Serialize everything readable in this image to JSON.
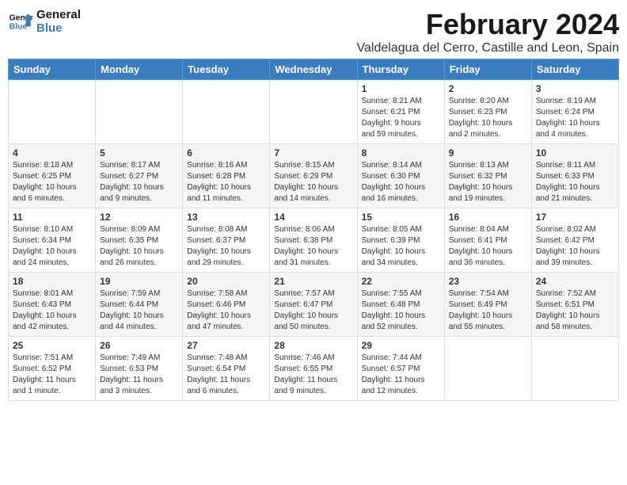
{
  "header": {
    "logo_line1": "General",
    "logo_line2": "Blue",
    "month_title": "February 2024",
    "location": "Valdelagua del Cerro, Castille and Leon, Spain"
  },
  "weekdays": [
    "Sunday",
    "Monday",
    "Tuesday",
    "Wednesday",
    "Thursday",
    "Friday",
    "Saturday"
  ],
  "weeks": [
    [
      {
        "day": "",
        "info": ""
      },
      {
        "day": "",
        "info": ""
      },
      {
        "day": "",
        "info": ""
      },
      {
        "day": "",
        "info": ""
      },
      {
        "day": "1",
        "info": "Sunrise: 8:21 AM\nSunset: 6:21 PM\nDaylight: 9 hours\nand 59 minutes."
      },
      {
        "day": "2",
        "info": "Sunrise: 8:20 AM\nSunset: 6:23 PM\nDaylight: 10 hours\nand 2 minutes."
      },
      {
        "day": "3",
        "info": "Sunrise: 8:19 AM\nSunset: 6:24 PM\nDaylight: 10 hours\nand 4 minutes."
      }
    ],
    [
      {
        "day": "4",
        "info": "Sunrise: 8:18 AM\nSunset: 6:25 PM\nDaylight: 10 hours\nand 6 minutes."
      },
      {
        "day": "5",
        "info": "Sunrise: 8:17 AM\nSunset: 6:27 PM\nDaylight: 10 hours\nand 9 minutes."
      },
      {
        "day": "6",
        "info": "Sunrise: 8:16 AM\nSunset: 6:28 PM\nDaylight: 10 hours\nand 11 minutes."
      },
      {
        "day": "7",
        "info": "Sunrise: 8:15 AM\nSunset: 6:29 PM\nDaylight: 10 hours\nand 14 minutes."
      },
      {
        "day": "8",
        "info": "Sunrise: 8:14 AM\nSunset: 6:30 PM\nDaylight: 10 hours\nand 16 minutes."
      },
      {
        "day": "9",
        "info": "Sunrise: 8:13 AM\nSunset: 6:32 PM\nDaylight: 10 hours\nand 19 minutes."
      },
      {
        "day": "10",
        "info": "Sunrise: 8:11 AM\nSunset: 6:33 PM\nDaylight: 10 hours\nand 21 minutes."
      }
    ],
    [
      {
        "day": "11",
        "info": "Sunrise: 8:10 AM\nSunset: 6:34 PM\nDaylight: 10 hours\nand 24 minutes."
      },
      {
        "day": "12",
        "info": "Sunrise: 8:09 AM\nSunset: 6:35 PM\nDaylight: 10 hours\nand 26 minutes."
      },
      {
        "day": "13",
        "info": "Sunrise: 8:08 AM\nSunset: 6:37 PM\nDaylight: 10 hours\nand 29 minutes."
      },
      {
        "day": "14",
        "info": "Sunrise: 8:06 AM\nSunset: 6:38 PM\nDaylight: 10 hours\nand 31 minutes."
      },
      {
        "day": "15",
        "info": "Sunrise: 8:05 AM\nSunset: 6:39 PM\nDaylight: 10 hours\nand 34 minutes."
      },
      {
        "day": "16",
        "info": "Sunrise: 8:04 AM\nSunset: 6:41 PM\nDaylight: 10 hours\nand 36 minutes."
      },
      {
        "day": "17",
        "info": "Sunrise: 8:02 AM\nSunset: 6:42 PM\nDaylight: 10 hours\nand 39 minutes."
      }
    ],
    [
      {
        "day": "18",
        "info": "Sunrise: 8:01 AM\nSunset: 6:43 PM\nDaylight: 10 hours\nand 42 minutes."
      },
      {
        "day": "19",
        "info": "Sunrise: 7:59 AM\nSunset: 6:44 PM\nDaylight: 10 hours\nand 44 minutes."
      },
      {
        "day": "20",
        "info": "Sunrise: 7:58 AM\nSunset: 6:46 PM\nDaylight: 10 hours\nand 47 minutes."
      },
      {
        "day": "21",
        "info": "Sunrise: 7:57 AM\nSunset: 6:47 PM\nDaylight: 10 hours\nand 50 minutes."
      },
      {
        "day": "22",
        "info": "Sunrise: 7:55 AM\nSunset: 6:48 PM\nDaylight: 10 hours\nand 52 minutes."
      },
      {
        "day": "23",
        "info": "Sunrise: 7:54 AM\nSunset: 6:49 PM\nDaylight: 10 hours\nand 55 minutes."
      },
      {
        "day": "24",
        "info": "Sunrise: 7:52 AM\nSunset: 6:51 PM\nDaylight: 10 hours\nand 58 minutes."
      }
    ],
    [
      {
        "day": "25",
        "info": "Sunrise: 7:51 AM\nSunset: 6:52 PM\nDaylight: 11 hours\nand 1 minute."
      },
      {
        "day": "26",
        "info": "Sunrise: 7:49 AM\nSunset: 6:53 PM\nDaylight: 11 hours\nand 3 minutes."
      },
      {
        "day": "27",
        "info": "Sunrise: 7:48 AM\nSunset: 6:54 PM\nDaylight: 11 hours\nand 6 minutes."
      },
      {
        "day": "28",
        "info": "Sunrise: 7:46 AM\nSunset: 6:55 PM\nDaylight: 11 hours\nand 9 minutes."
      },
      {
        "day": "29",
        "info": "Sunrise: 7:44 AM\nSunset: 6:57 PM\nDaylight: 11 hours\nand 12 minutes."
      },
      {
        "day": "",
        "info": ""
      },
      {
        "day": "",
        "info": ""
      }
    ]
  ]
}
